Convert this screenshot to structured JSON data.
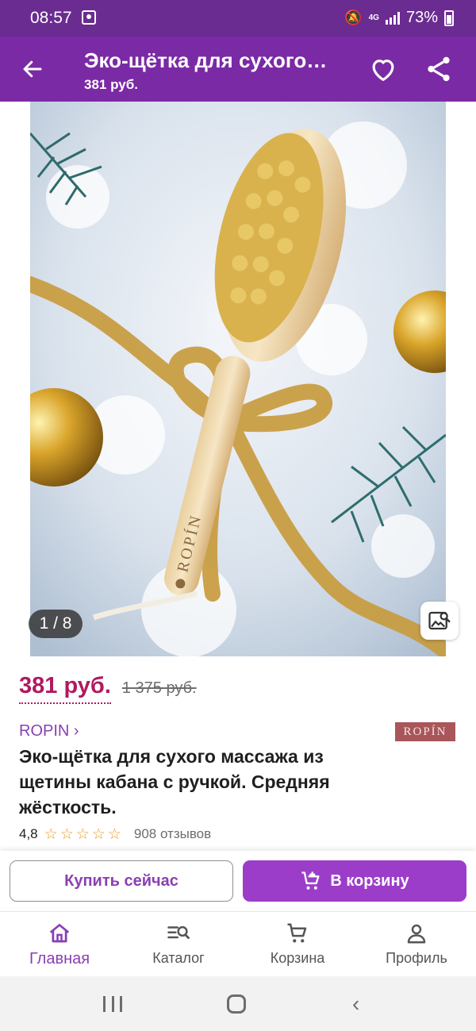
{
  "status_bar": {
    "time": "08:57",
    "battery": "73%",
    "network": "4G"
  },
  "app_bar": {
    "title": "Эко-щётка для сухого…",
    "subtitle": "381 руб."
  },
  "gallery": {
    "counter": "1 / 8",
    "brand_engraving": "ROPÍN"
  },
  "price": {
    "current": "381 руб.",
    "old": "1 375 руб."
  },
  "brand": {
    "link": "ROPIN ›",
    "logo_text": "ROPÍN"
  },
  "product": {
    "title": "Эко-щётка для сухого массажа из щетины кабана с ручкой. Средняя жёсткость."
  },
  "rating": {
    "value": "4,8",
    "stars": 5,
    "reviews": "908 отзывов"
  },
  "actions": {
    "buy_now": "Купить сейчас",
    "add_to_cart": "В корзину"
  },
  "bottom_nav": {
    "items": [
      {
        "label": "Главная",
        "icon": "home-icon",
        "active": true
      },
      {
        "label": "Каталог",
        "icon": "catalog-search-icon",
        "active": false
      },
      {
        "label": "Корзина",
        "icon": "cart-icon",
        "active": false
      },
      {
        "label": "Профиль",
        "icon": "profile-icon",
        "active": false
      }
    ]
  },
  "colors": {
    "app_bar": "#7b2aa5",
    "status_bar": "#6b2c91",
    "accent": "#9c3dca",
    "price": "#b0195f",
    "star": "#f19b2b"
  }
}
